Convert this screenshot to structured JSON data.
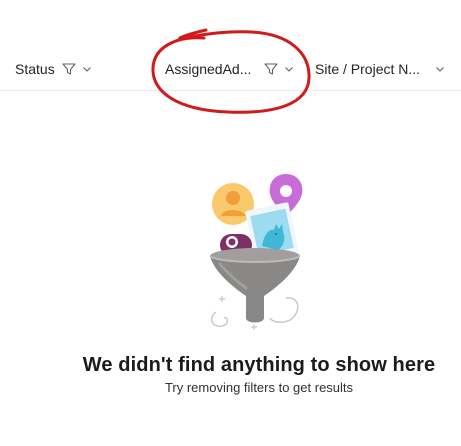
{
  "header": {
    "columns": [
      {
        "label": "Status",
        "filter_icon": "filter-icon",
        "menu_icon": "chevron-down-icon"
      },
      {
        "label": "AssignedAd...",
        "filter_icon": "filter-icon",
        "menu_icon": "chevron-down-icon"
      },
      {
        "label": "Site / Project N...",
        "menu_icon": "chevron-down-icon"
      }
    ]
  },
  "annotation": {
    "color": "#d11a1a",
    "shape": "hand-drawn-circle"
  },
  "empty_state": {
    "illustration": "funnel-filter-illustration",
    "title": "We didn't find anything to show here",
    "subtitle": "Try removing filters to get results"
  },
  "colors": {
    "divider": "#edebe9",
    "text": "#242424",
    "annotation_red": "#d11a1a"
  }
}
